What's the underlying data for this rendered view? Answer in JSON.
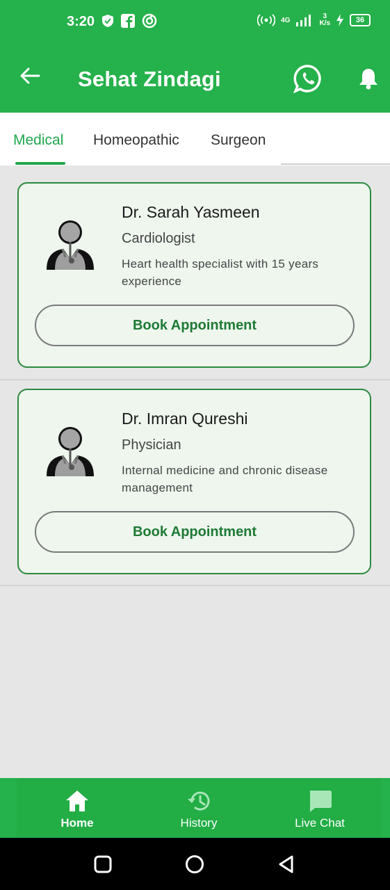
{
  "status_bar": {
    "time": "3:20",
    "network": "4G",
    "speed_value": "3",
    "speed_unit": "K/s",
    "battery": "36"
  },
  "app_bar": {
    "title": "Sehat Zindagi",
    "icons": [
      "back-arrow-icon",
      "whatsapp-icon",
      "bell-icon"
    ]
  },
  "tabs": [
    {
      "label": "Medical",
      "active": true
    },
    {
      "label": "Homeopathic",
      "active": false
    },
    {
      "label": "Surgeon",
      "active": false
    }
  ],
  "doctors": [
    {
      "name": "Dr. Sarah Yasmeen",
      "specialty": "Cardiologist",
      "description": "Heart health specialist with 15 years experience",
      "button_label": "Book Appointment"
    },
    {
      "name": "Dr. Imran Qureshi",
      "specialty": "Physician",
      "description": "Internal medicine and chronic disease management",
      "button_label": "Book Appointment"
    }
  ],
  "bottom_nav": [
    {
      "label": "Home",
      "icon": "home-icon",
      "active": true
    },
    {
      "label": "History",
      "icon": "history-icon",
      "active": false
    },
    {
      "label": "Live Chat",
      "icon": "chat-icon",
      "active": false
    }
  ],
  "colors": {
    "primary_green": "#25b14b",
    "tab_active": "#1fa64b",
    "card_border": "#2b8a3e",
    "card_bg": "#eef6ee",
    "button_text": "#1e7a34"
  }
}
